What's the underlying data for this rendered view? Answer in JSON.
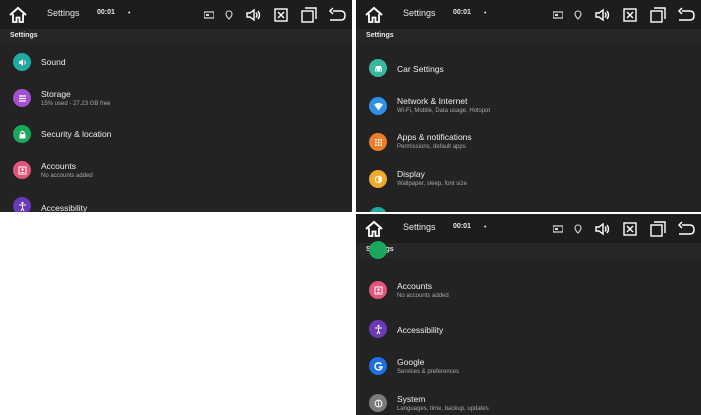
{
  "status": {
    "title": "Settings",
    "time": "00:01",
    "dot": "•"
  },
  "subheader": "Settings",
  "left_panel": {
    "items": [
      {
        "title": "Sound",
        "subtitle": ""
      },
      {
        "title": "Storage",
        "subtitle": "15% used - 27.23 GB free"
      },
      {
        "title": "Security & location",
        "subtitle": ""
      },
      {
        "title": "Accounts",
        "subtitle": "No accounts added"
      },
      {
        "title": "Accessibility",
        "subtitle": ""
      }
    ]
  },
  "right_top_panel": {
    "items": [
      {
        "title": "Car Settings",
        "subtitle": ""
      },
      {
        "title": "Network & Internet",
        "subtitle": "Wi-Fi, Mobile, Data usage, Hotspot"
      },
      {
        "title": "Apps & notifications",
        "subtitle": "Permissions, default apps"
      },
      {
        "title": "Display",
        "subtitle": "Wallpaper, sleep, font size"
      }
    ]
  },
  "right_bottom_panel": {
    "items": [
      {
        "title": "Accounts",
        "subtitle": "No accounts added"
      },
      {
        "title": "Accessibility",
        "subtitle": ""
      },
      {
        "title": "Google",
        "subtitle": "Services & preferences"
      },
      {
        "title": "System",
        "subtitle": "Languages, time, backup, updates"
      }
    ]
  },
  "colors": {
    "background": "#232323",
    "statusbar": "#1d1d1d",
    "sound": "#1fa9a0",
    "storage": "#a24fd0",
    "security": "#19a85c",
    "accounts": "#e2557b",
    "accessibility": "#6a3ab8",
    "car": "#39b8a0",
    "network": "#2f8ee6",
    "apps": "#ee7d2a",
    "display": "#f0a92b",
    "google": "#1f6fe3",
    "system": "#7b7b7b"
  }
}
